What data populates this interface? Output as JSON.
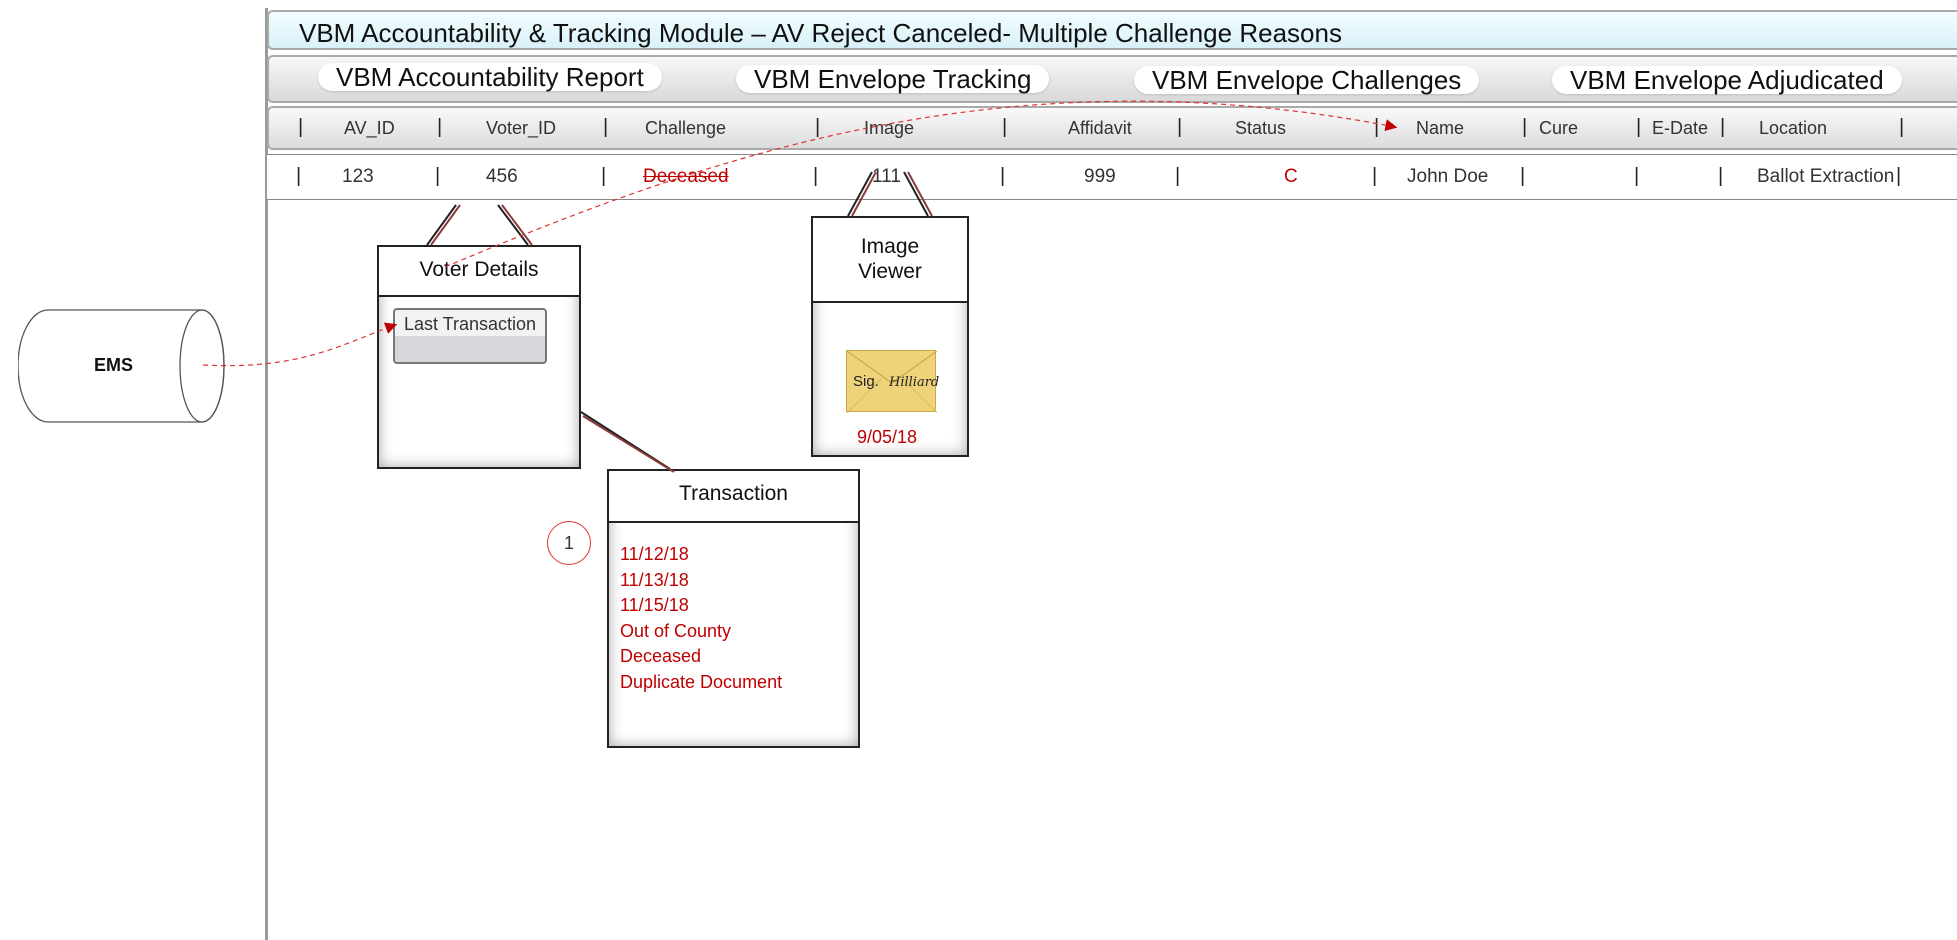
{
  "title": "VBM Accountability & Tracking Module – AV Reject Canceled- Multiple Challenge Reasons",
  "tabs": [
    "VBM Accountability Report",
    "VBM Envelope Tracking",
    "VBM Envelope Challenges",
    "VBM Envelope Adjudicated"
  ],
  "columns": {
    "av_id": "AV_ID",
    "voter_id": "Voter_ID",
    "challenge": "Challenge",
    "image": "Image",
    "affidavit": "Affidavit",
    "status": "Status",
    "name": "Name",
    "cure": "Cure",
    "edate": "E-Date",
    "location": "Location"
  },
  "row": {
    "av_id": "123",
    "voter_id": "456",
    "challenge": "Deceased",
    "image": "111",
    "affidavit": "999",
    "status": "C",
    "name": "John Doe",
    "cure": "",
    "edate": "",
    "location": "Ballot Extraction"
  },
  "separator": "|",
  "voter_details": {
    "title": "Voter Details",
    "button": "Last Transaction"
  },
  "image_viewer": {
    "title": "Image Viewer",
    "sig_label": "Sig.",
    "signature": "Hilliard",
    "date": "9/05/18"
  },
  "transaction": {
    "title": "Transaction",
    "lines": [
      "11/12/18",
      "11/13/18",
      "11/15/18",
      "Out of County",
      "Deceased",
      "Duplicate Document"
    ]
  },
  "ems": {
    "label": "EMS"
  },
  "step_marker": "1",
  "colors": {
    "accent_red": "#c00000",
    "title_bg": "#d8f1f8"
  }
}
